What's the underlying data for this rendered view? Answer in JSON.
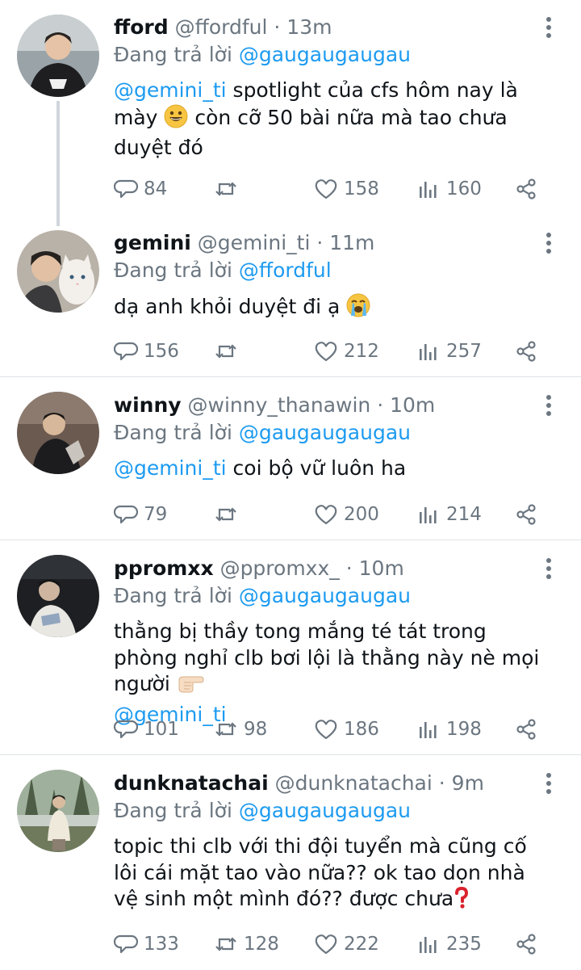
{
  "tweets": [
    {
      "name": "fford",
      "handle": "@ffordful",
      "dot": "·",
      "time": "13m",
      "reply_prefix": "Đang trả lời",
      "reply_to": "@gaugaugaugau",
      "text_mention": "@gemini_ti",
      "text_1": " spotlight của cfs hôm nay là mày ",
      "text_2": " còn cỡ 50 bài nữa mà tao chưa duyệt đó",
      "emoji": "grinning-face-emoji",
      "replies": "84",
      "retweets": "",
      "likes": "158",
      "views": "160"
    },
    {
      "name": "gemini",
      "handle": "@gemini_ti",
      "dot": "·",
      "time": "11m",
      "reply_prefix": "Đang trả lời",
      "reply_to": "@ffordful",
      "text_1": "dạ anh khỏi duyệt đi ạ ",
      "emoji": "loudly-crying-face-emoji",
      "replies": "156",
      "retweets": "",
      "likes": "212",
      "views": "257"
    },
    {
      "name": "winny",
      "handle": "@winny_thanawin",
      "dot": "·",
      "time": "10m",
      "reply_prefix": "Đang trả lời",
      "reply_to": "@gaugaugaugau",
      "text_mention": "@gemini_ti",
      "text_1": " coi bộ vữ luôn ha",
      "replies": "79",
      "retweets": "",
      "likes": "200",
      "views": "214"
    },
    {
      "name": "ppromxx",
      "handle": "@ppromxx_",
      "dot": "·",
      "time": "10m",
      "reply_prefix": "Đang trả lời",
      "reply_to": "@gaugaugaugau",
      "text_1": "thằng bị thầy tong mắng té tát trong phòng nghỉ clb bơi lội là thằng này nè mọi người ",
      "emoji": "backhand-index-pointing-right-emoji",
      "text_mention_end": "@gemini_ti",
      "replies": "101",
      "retweets": "98",
      "likes": "186",
      "views": "198"
    },
    {
      "name": "dunknatachai",
      "handle": "@dunknatachai",
      "dot": "·",
      "time": "9m",
      "reply_prefix": "Đang trả lời",
      "reply_to": "@gaugaugaugau",
      "text_1": "topic thi clb với thi đội tuyển mà cũng cố lôi cái mặt tao vào nữa?? ok tao dọn nhà vệ sinh một mình đó?? được chưa",
      "emoji": "red-question-mark-emoji",
      "replies": "133",
      "retweets": "128",
      "likes": "222",
      "views": "235"
    }
  ],
  "colors": {
    "accent": "#1d9bf0",
    "muted": "#6b7680",
    "text": "#0f1419",
    "divider": "#dfe3e6",
    "thread_line": "#d0d6dc"
  }
}
